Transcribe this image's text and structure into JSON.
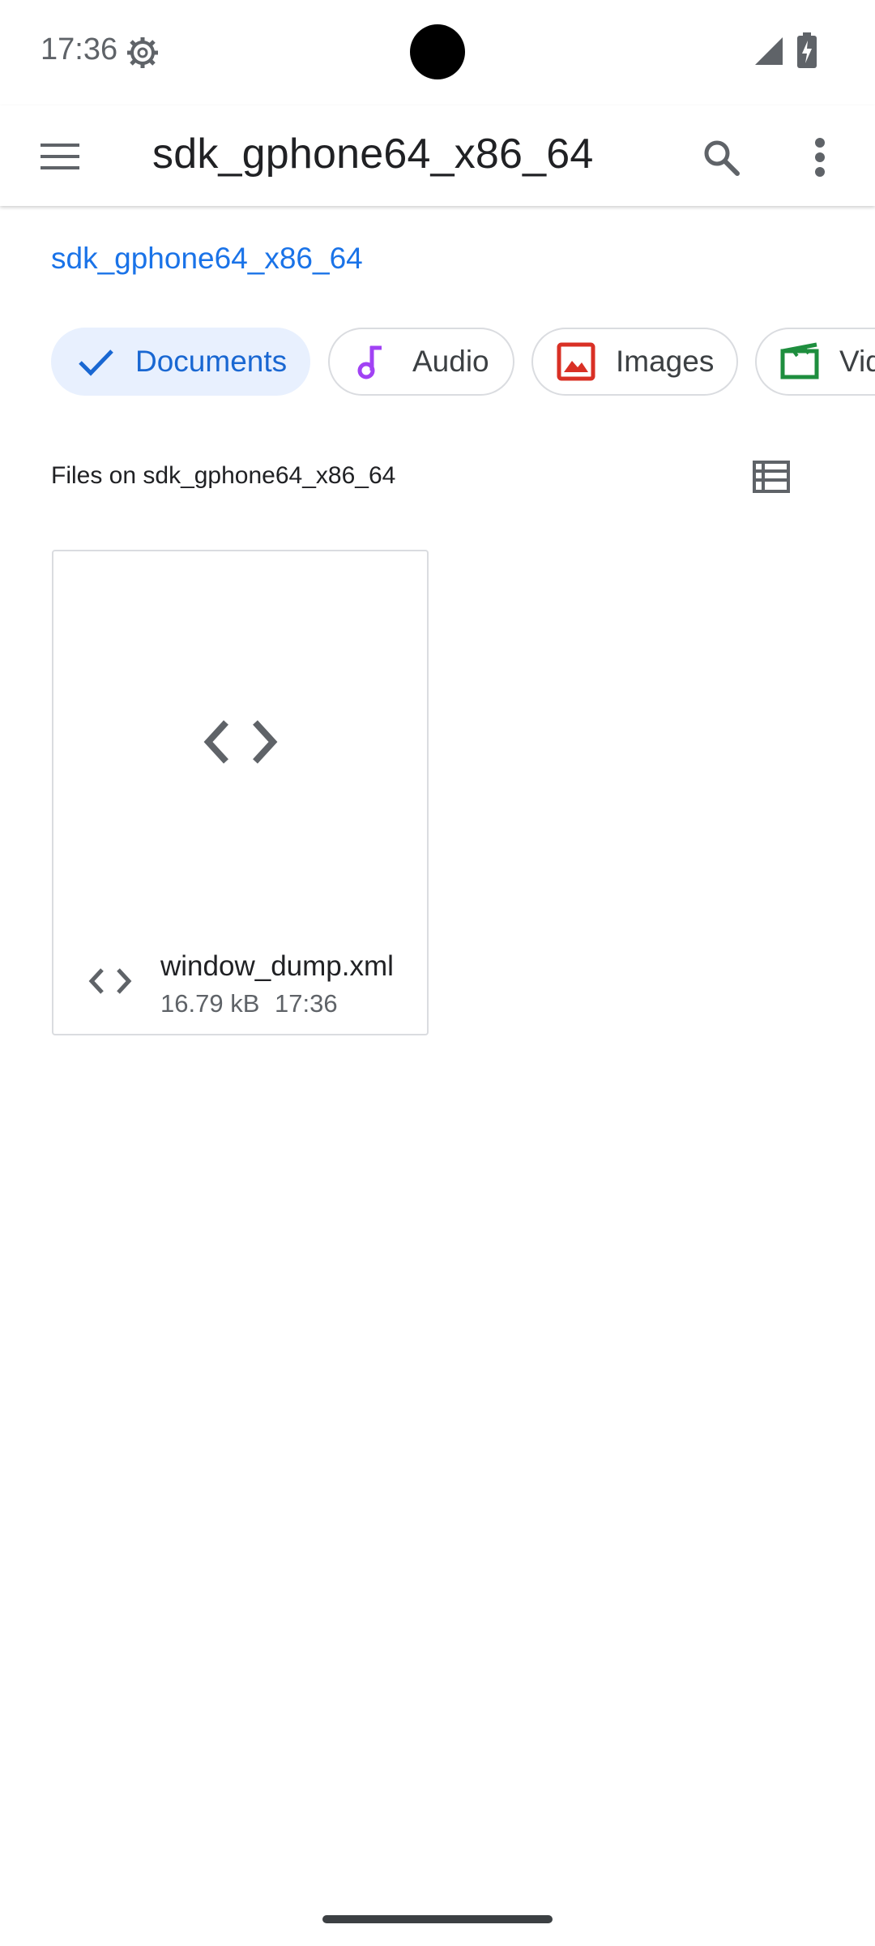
{
  "status_bar": {
    "time": "17:36",
    "icons": [
      "settings-gear-icon",
      "cell-signal-icon",
      "battery-charging-icon"
    ]
  },
  "app_bar": {
    "title": "sdk_gphone64_x86_64",
    "icons": [
      "menu-icon",
      "search-icon",
      "more-vert-icon"
    ]
  },
  "breadcrumb": {
    "root": "sdk_gphone64_x86_64"
  },
  "chips": [
    {
      "label": "Documents",
      "icon": "check-icon",
      "selected": true
    },
    {
      "label": "Audio",
      "icon": "music-note-icon",
      "selected": false
    },
    {
      "label": "Images",
      "icon": "image-icon",
      "selected": false
    },
    {
      "label": "Videos",
      "icon": "movie-clapper-icon",
      "selected": false
    }
  ],
  "section": {
    "title": "Files on sdk_gphone64_x86_64",
    "view_icon": "list-view-icon"
  },
  "files": [
    {
      "name": "window_dump.xml",
      "size": "16.79 kB",
      "time": "17:36",
      "icon": "code-icon"
    }
  ],
  "colors": {
    "accent": "#1a73e8",
    "chip_selected_bg": "#e8f0fe",
    "audio_icon": "#a142f4",
    "images_icon": "#d93025",
    "videos_icon": "#1e8e3e"
  }
}
